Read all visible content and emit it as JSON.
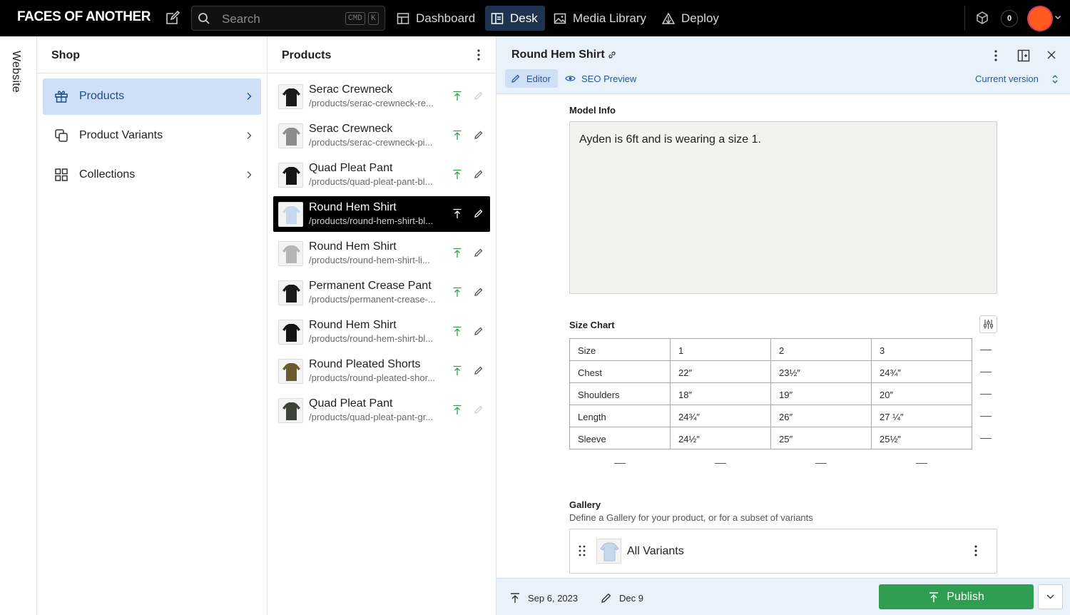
{
  "app": {
    "brand": "FACES OF ANOTHER",
    "search_placeholder": "Search",
    "search_kbd1": "CMD",
    "search_kbd2": "K",
    "nav": [
      {
        "label": "Dashboard",
        "icon": "dashboard-icon"
      },
      {
        "label": "Desk",
        "icon": "desk-icon",
        "active": true
      },
      {
        "label": "Media Library",
        "icon": "image-icon"
      },
      {
        "label": "Deploy",
        "icon": "deploy-icon"
      }
    ],
    "notifications": "0",
    "accent": "#1e3350",
    "avatar_color": "#ff5a1f"
  },
  "rail": {
    "label": "Website"
  },
  "shop": {
    "title": "Shop",
    "items": [
      {
        "label": "Products",
        "icon": "gift-icon",
        "selected": true
      },
      {
        "label": "Product Variants",
        "icon": "copy-icon"
      },
      {
        "label": "Collections",
        "icon": "grid-icon"
      }
    ]
  },
  "products": {
    "title": "Products",
    "items": [
      {
        "name": "Serac Crewneck",
        "slug": "/products/serac-crewneck-re...",
        "thumb": "#1a1a1a"
      },
      {
        "name": "Serac Crewneck",
        "slug": "/products/serac-crewneck-pi...",
        "thumb": "#8c8c8c"
      },
      {
        "name": "Quad Pleat Pant",
        "slug": "/products/quad-pleat-pant-bl...",
        "thumb": "#151515"
      },
      {
        "name": "Round Hem Shirt",
        "slug": "/products/round-hem-shirt-bl...",
        "thumb": "#c6d8ee",
        "selected": true
      },
      {
        "name": "Round Hem Shirt",
        "slug": "/products/round-hem-shirt-li...",
        "thumb": "#b5b5b5"
      },
      {
        "name": "Permanent Crease Pant",
        "slug": "/products/permanent-crease-...",
        "thumb": "#1a1a1a"
      },
      {
        "name": "Round Hem Shirt",
        "slug": "/products/round-hem-shirt-bl...",
        "thumb": "#141414"
      },
      {
        "name": "Round Pleated Shorts",
        "slug": "/products/round-pleated-shor...",
        "thumb": "#6b5a2e"
      },
      {
        "name": "Quad Pleat Pant",
        "slug": "/products/quad-pleat-pant-gr...",
        "thumb": "#3d4237"
      }
    ]
  },
  "editor": {
    "title": "Round Hem Shirt",
    "tabs": [
      "Editor",
      "SEO Preview"
    ],
    "version": "Current version",
    "model_info_label": "Model Info",
    "model_info_value": "Ayden is 6ft and is wearing a size 1.",
    "size_chart_label": "Size Chart",
    "size_chart": [
      [
        "Size",
        "1",
        "2",
        "3"
      ],
      [
        "Chest",
        "22″",
        "23½″",
        "24¾″"
      ],
      [
        "Shoulders",
        "18″",
        "19″",
        "20″"
      ],
      [
        "Length",
        "24¾″",
        "26″",
        "27 ¼″"
      ],
      [
        "Sleeve",
        "24½″",
        "25″",
        "25½″"
      ]
    ],
    "gallery_label": "Gallery",
    "gallery_desc": "Define a Gallery for your product, or for a subset of variants",
    "gallery_item": "All Variants",
    "published_date": "Sep 6, 2023",
    "edited_date": "Dec 9",
    "publish_label": "Publish",
    "publish_color": "#2f9e52"
  }
}
